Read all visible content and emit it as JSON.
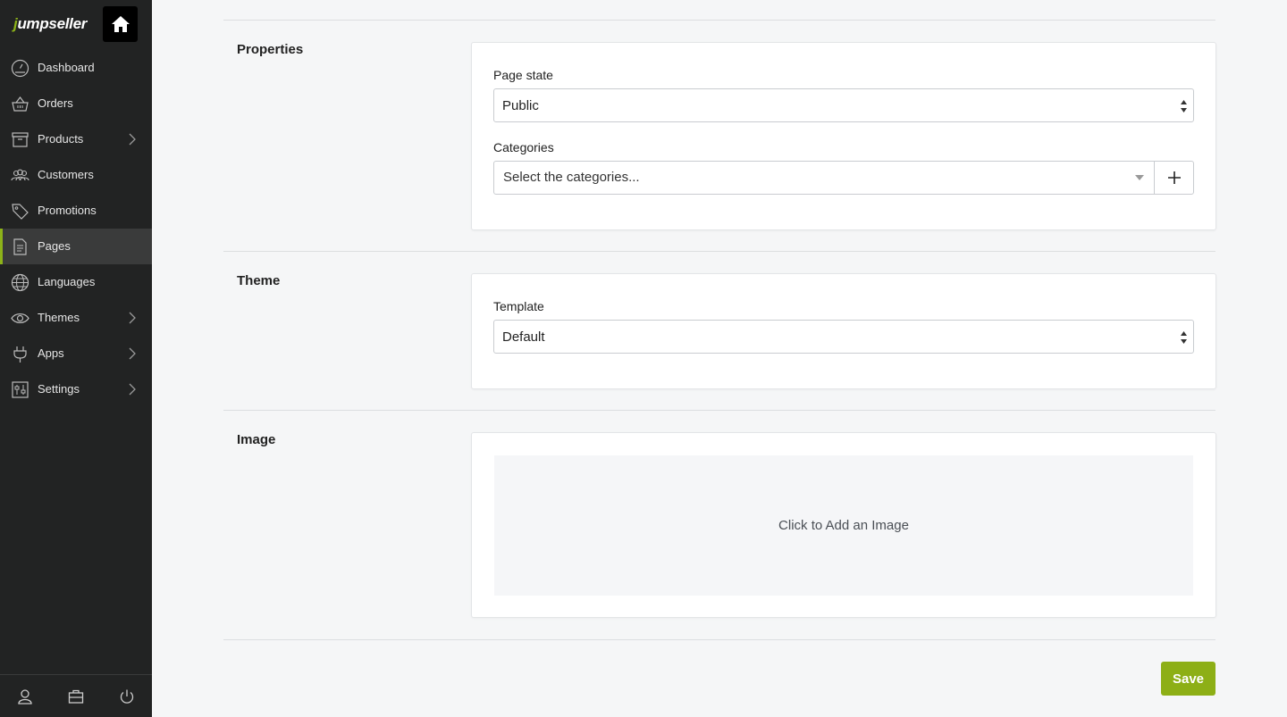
{
  "brand": {
    "logo_first": "j",
    "logo_rest": "umpseller"
  },
  "sidebar": {
    "items": [
      {
        "label": "Dashboard",
        "icon": "gauge-icon",
        "has_children": false,
        "active": false
      },
      {
        "label": "Orders",
        "icon": "basket-icon",
        "has_children": false,
        "active": false
      },
      {
        "label": "Products",
        "icon": "box-icon",
        "has_children": true,
        "active": false
      },
      {
        "label": "Customers",
        "icon": "people-icon",
        "has_children": false,
        "active": false
      },
      {
        "label": "Promotions",
        "icon": "tag-icon",
        "has_children": false,
        "active": false
      },
      {
        "label": "Pages",
        "icon": "document-icon",
        "has_children": false,
        "active": true
      },
      {
        "label": "Languages",
        "icon": "globe-icon",
        "has_children": false,
        "active": false
      },
      {
        "label": "Themes",
        "icon": "eye-icon",
        "has_children": true,
        "active": false
      },
      {
        "label": "Apps",
        "icon": "plug-icon",
        "has_children": true,
        "active": false
      },
      {
        "label": "Settings",
        "icon": "sliders-icon",
        "has_children": true,
        "active": false
      }
    ],
    "bottom": [
      "user-icon",
      "briefcase-icon",
      "power-icon"
    ]
  },
  "sections": {
    "properties": {
      "title": "Properties",
      "page_state_label": "Page state",
      "page_state_value": "Public",
      "categories_label": "Categories",
      "categories_placeholder": "Select the categories..."
    },
    "theme": {
      "title": "Theme",
      "template_label": "Template",
      "template_value": "Default"
    },
    "image": {
      "title": "Image",
      "dropzone_text": "Click to Add an Image"
    }
  },
  "actions": {
    "save_label": "Save"
  },
  "colors": {
    "accent": "#8db319",
    "sidebar_bg": "#222323",
    "save_bg": "#8daf16"
  }
}
